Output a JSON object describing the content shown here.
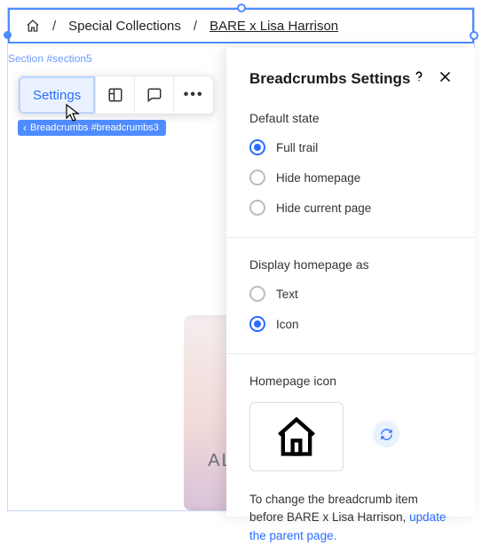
{
  "stage": {
    "section_label": "Section #section5",
    "breadcrumbs": {
      "items": [
        "Special Collections",
        "BARE x Lisa Harrison"
      ],
      "crumb_tag": "Breadcrumbs #breadcrumbs3"
    },
    "toolbar": {
      "settings_label": "Settings"
    },
    "product_label": "ALLOY"
  },
  "panel": {
    "title": "Breadcrumbs Settings",
    "default_state": {
      "label": "Default state",
      "options": [
        "Full trail",
        "Hide homepage",
        "Hide current page"
      ],
      "selected": 0
    },
    "display_homepage": {
      "label": "Display homepage as",
      "options": [
        "Text",
        "Icon"
      ],
      "selected": 1
    },
    "homepage_icon_label": "Homepage icon",
    "note_prefix": "To change the breadcrumb item before BARE x Lisa Harrison, ",
    "note_link": "update the parent page."
  }
}
